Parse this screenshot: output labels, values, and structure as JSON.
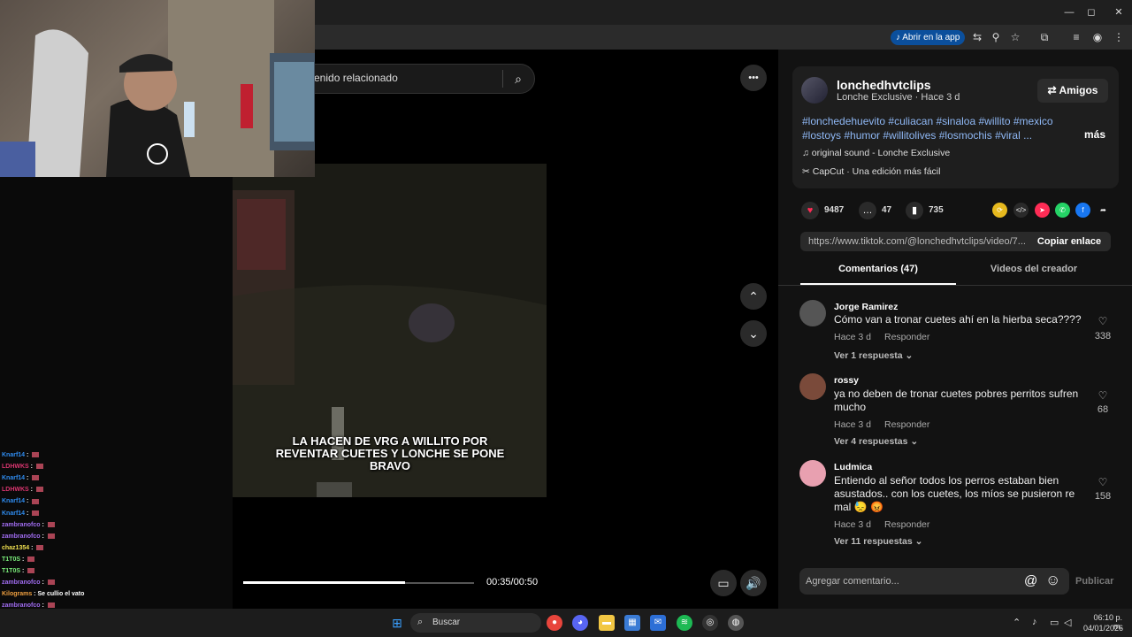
{
  "browser": {
    "open_in_app_label": "Abrir en la app",
    "open_in_app_icon": "tiktok-icon"
  },
  "window_controls": {
    "minimize": "—",
    "maximize": "◻",
    "close": "✕"
  },
  "toolbar_icons": {
    "translate": "⇆",
    "zoom": "⚲",
    "star": "☆",
    "extensions": "⧉",
    "menu": "⋮"
  },
  "search": {
    "visible_text": "enido relacionado",
    "icon": "search-icon"
  },
  "video": {
    "caption": "LA HACEN DE VRG A WILLITO POR REVENTAR CUETES Y LONCHE SE PONE BRAVO",
    "time": "00:35/00:50",
    "progress": 0.7,
    "more_icon": "•••",
    "up_icon": "⌃",
    "down_icon": "⌄",
    "volume_icon": "🔊",
    "mini_icon": "▭"
  },
  "chat": [
    {
      "user": "Knarf14",
      "msg": "",
      "color": "#2f8cf0"
    },
    {
      "user": "LDHWKS",
      "msg": "",
      "color": "#d9356f"
    },
    {
      "user": "Knarf14",
      "msg": "",
      "color": "#2f8cf0"
    },
    {
      "user": "LDHWKS",
      "msg": "",
      "color": "#d9356f"
    },
    {
      "user": "Knarf14",
      "msg": "",
      "color": "#2f8cf0"
    },
    {
      "user": "Knarf14",
      "msg": "",
      "color": "#2f8cf0"
    },
    {
      "user": "zambranofco",
      "msg": "",
      "color": "#a06cf0"
    },
    {
      "user": "zambranofco",
      "msg": "",
      "color": "#a06cf0"
    },
    {
      "user": "chaz1354",
      "msg": "",
      "color": "#f0e050"
    },
    {
      "user": "T1T0S",
      "msg": "",
      "color": "#7cf07c"
    },
    {
      "user": "T1T0S",
      "msg": "",
      "color": "#7cf07c"
    },
    {
      "user": "zambranofco",
      "msg": "",
      "color": "#a06cf0"
    },
    {
      "user": "Kilograms",
      "msg": "Se cullio el vato",
      "color": "#f0a040"
    },
    {
      "user": "zambranofco",
      "msg": "",
      "color": "#a06cf0"
    },
    {
      "user": "zambranofco",
      "msg": "",
      "color": "#a06cf0"
    },
    {
      "user": "chaz1354",
      "msg": "",
      "color": "#f0e050"
    }
  ],
  "post": {
    "username": "lonchedhvtclips",
    "subline": "Lonche Exclusive · Hace 3 d",
    "friends_label": "⇄ Amigos",
    "tags": "#lonchedehuevito #culiacan #sinaloa #willito #mexico #lostoys #humor #willitolives #losmochis #viral ...",
    "more_label": "más",
    "sound": "original sound - Lonche Exclusive",
    "capcut": "CapCut · Una edición más fácil",
    "likes": "9487",
    "comments": "47",
    "saves": "735",
    "link": "https://www.tiktok.com/@lonchedhvtclips/video/7...",
    "copy_label": "Copiar enlace",
    "tab_comments": "Comentarios (47)",
    "tab_creator": "Videos del creador"
  },
  "comments": [
    {
      "name": "Jorge Ramirez",
      "text": "Cómo van a tronar cuetes ahí en la hierba seca????",
      "time": "Hace 3 d",
      "reply": "Responder",
      "more": "Ver 1 respuesta ⌄",
      "likes": "338",
      "avatar_color": "#555"
    },
    {
      "name": "rossy",
      "text": "ya no deben de tronar cuetes pobres perritos sufren mucho",
      "time": "Hace 3 d",
      "reply": "Responder",
      "more": "Ver 4 respuestas ⌄",
      "likes": "68",
      "avatar_color": "#7a4a3a"
    },
    {
      "name": "Ludmica",
      "text": "Entiendo al señor todos los perros estaban bien asustados.. con los cuetes, los míos se pusieron re mal 😓 😡",
      "time": "Hace 3 d",
      "reply": "Responder",
      "more": "Ver 11 respuestas ⌄",
      "likes": "158",
      "avatar_color": "#e8a0b0"
    }
  ],
  "comment_input": {
    "placeholder": "Agregar comentario...",
    "at": "@",
    "emoji": "☺",
    "publish": "Publicar"
  },
  "taskbar": {
    "search_label": "Buscar",
    "time": "06:10 p. m.",
    "date": "04/01/2026"
  }
}
